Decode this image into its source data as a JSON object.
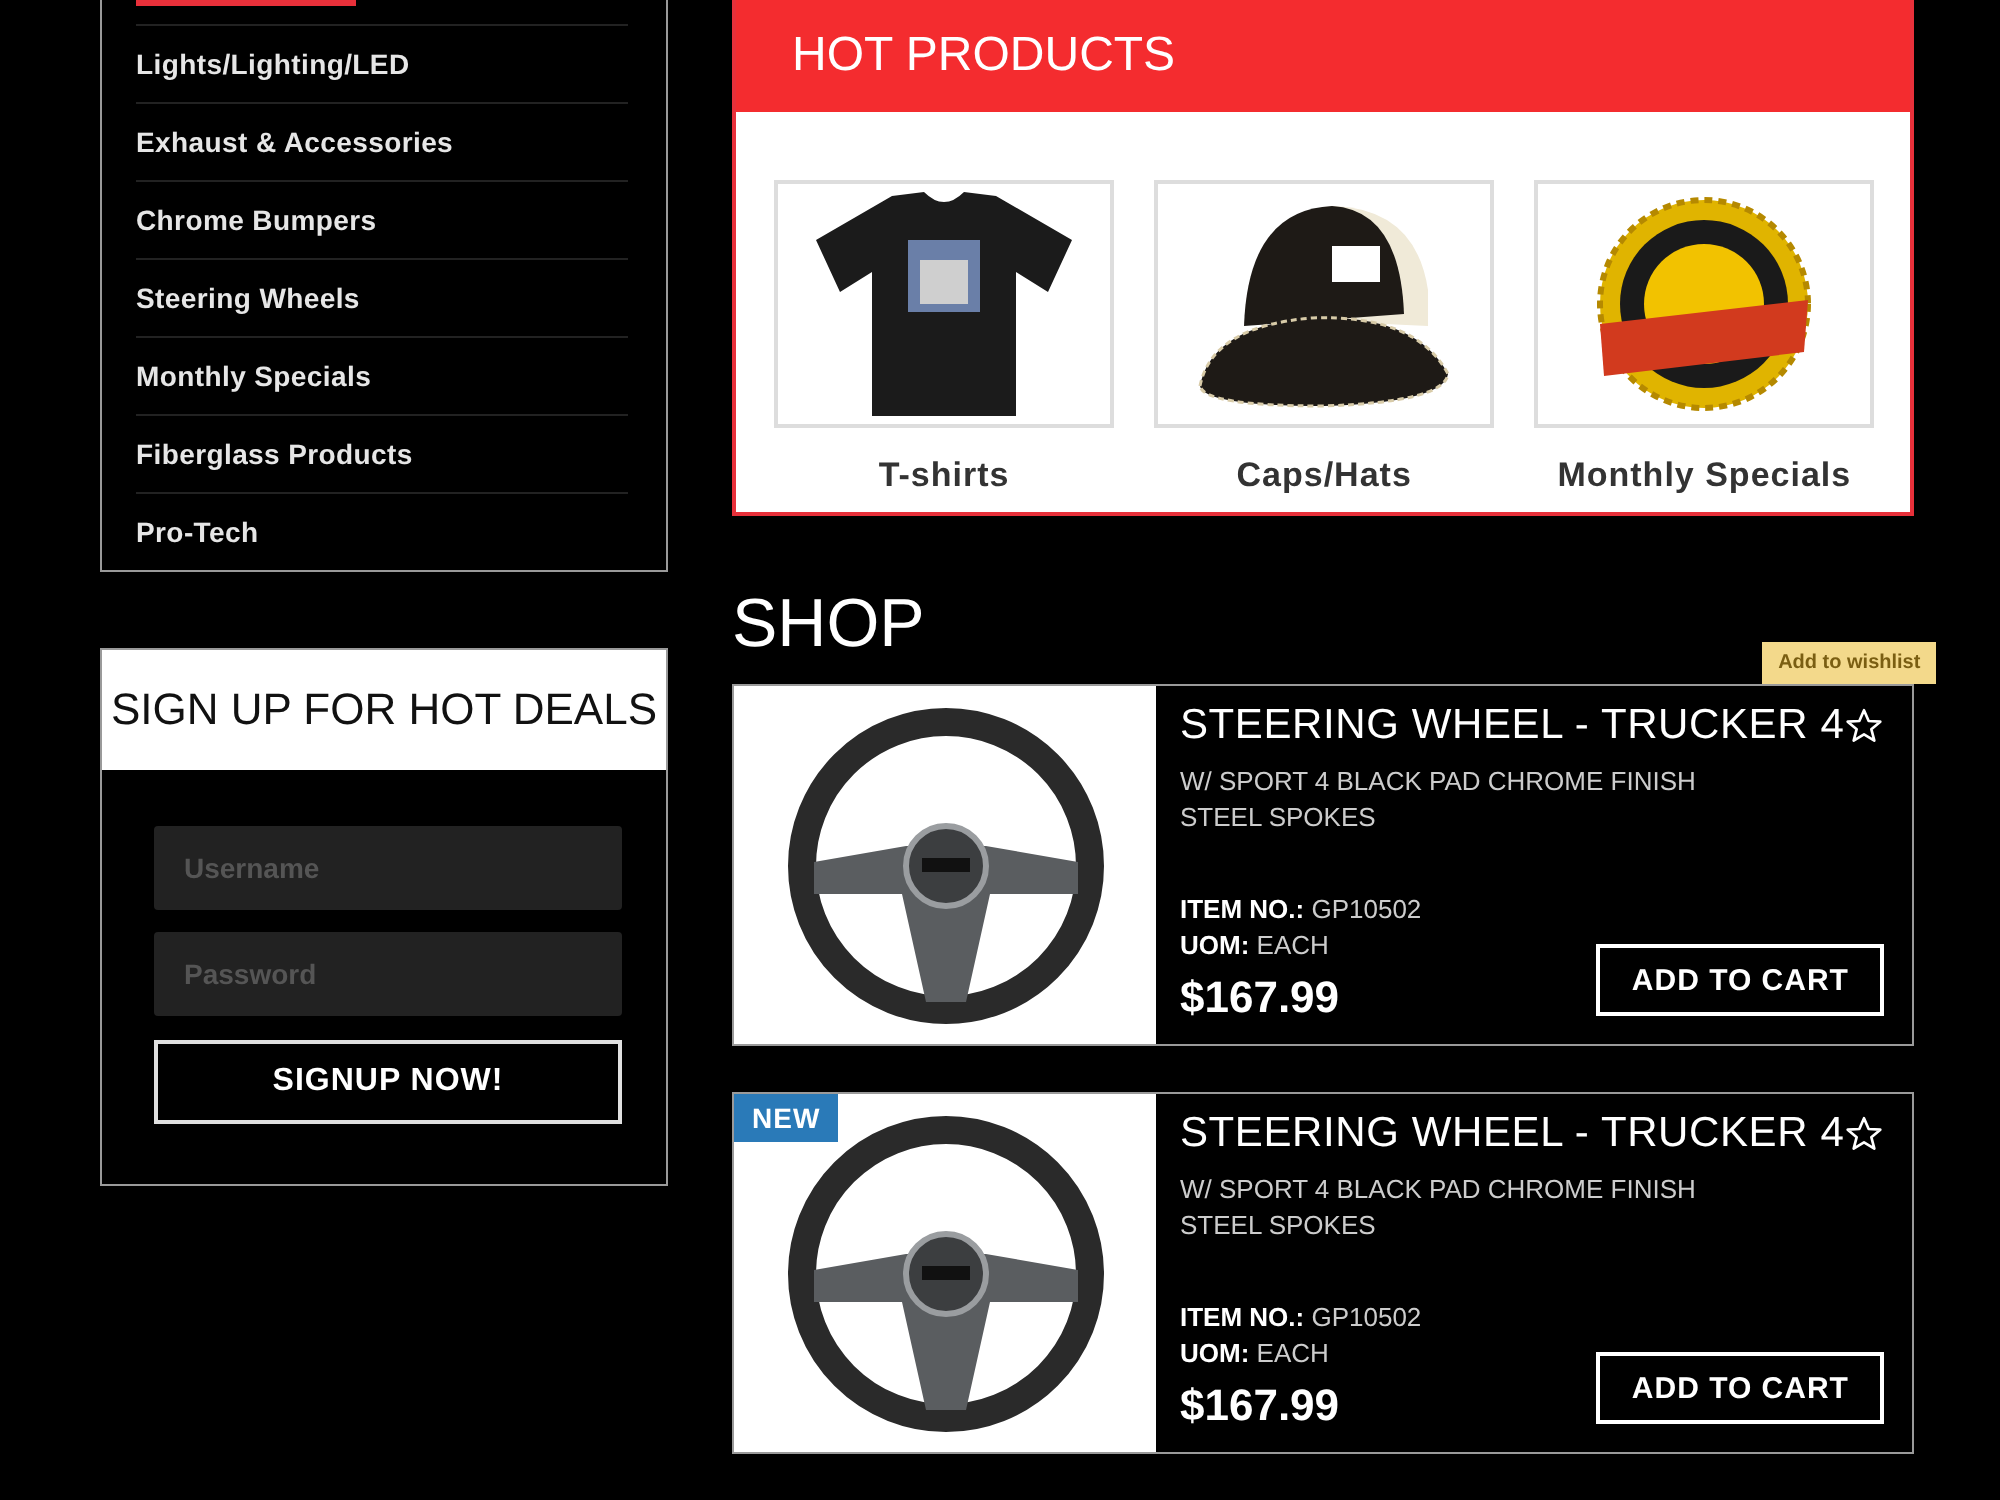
{
  "category_menu": {
    "items": [
      {
        "label": "Lights/Lighting/LED"
      },
      {
        "label": "Exhaust & Accessories"
      },
      {
        "label": "Chrome Bumpers"
      },
      {
        "label": "Steering Wheels"
      },
      {
        "label": "Monthly Specials"
      },
      {
        "label": "Fiberglass Products"
      },
      {
        "label": "Pro-Tech"
      }
    ]
  },
  "signup": {
    "title": "SIGN UP FOR HOT DEALS",
    "username": {
      "placeholder": "Username"
    },
    "password": {
      "placeholder": "Password"
    },
    "button": "SIGNUP NOW!"
  },
  "hot_products": {
    "title": "HOT PRODUCTS",
    "items": [
      {
        "label": "T-shirts",
        "kind": "tshirt"
      },
      {
        "label": "Caps/Hats",
        "kind": "cap"
      },
      {
        "label": "Monthly Specials",
        "kind": "badge"
      }
    ]
  },
  "shop": {
    "title": "SHOP",
    "products": [
      {
        "title": "STEERING WHEEL - TRUCKER 4",
        "description": "W/ SPORT 4 BLACK PAD CHROME FINISH STEEL SPOKES",
        "item_no_label": "ITEM NO.:",
        "item_no": "GP10502",
        "uom_label": "UOM:",
        "uom": "EACH",
        "price": "$167.99",
        "button": "ADD TO CART",
        "tooltip": "Add to wishlist"
      },
      {
        "title": "STEERING WHEEL - TRUCKER 4",
        "description": "W/ SPORT 4 BLACK PAD CHROME FINISH STEEL SPOKES",
        "item_no_label": "ITEM NO.:",
        "item_no": "GP10502",
        "uom_label": "UOM:",
        "uom": "EACH",
        "price": "$167.99",
        "button": "ADD TO CART",
        "badge": "NEW"
      }
    ]
  }
}
